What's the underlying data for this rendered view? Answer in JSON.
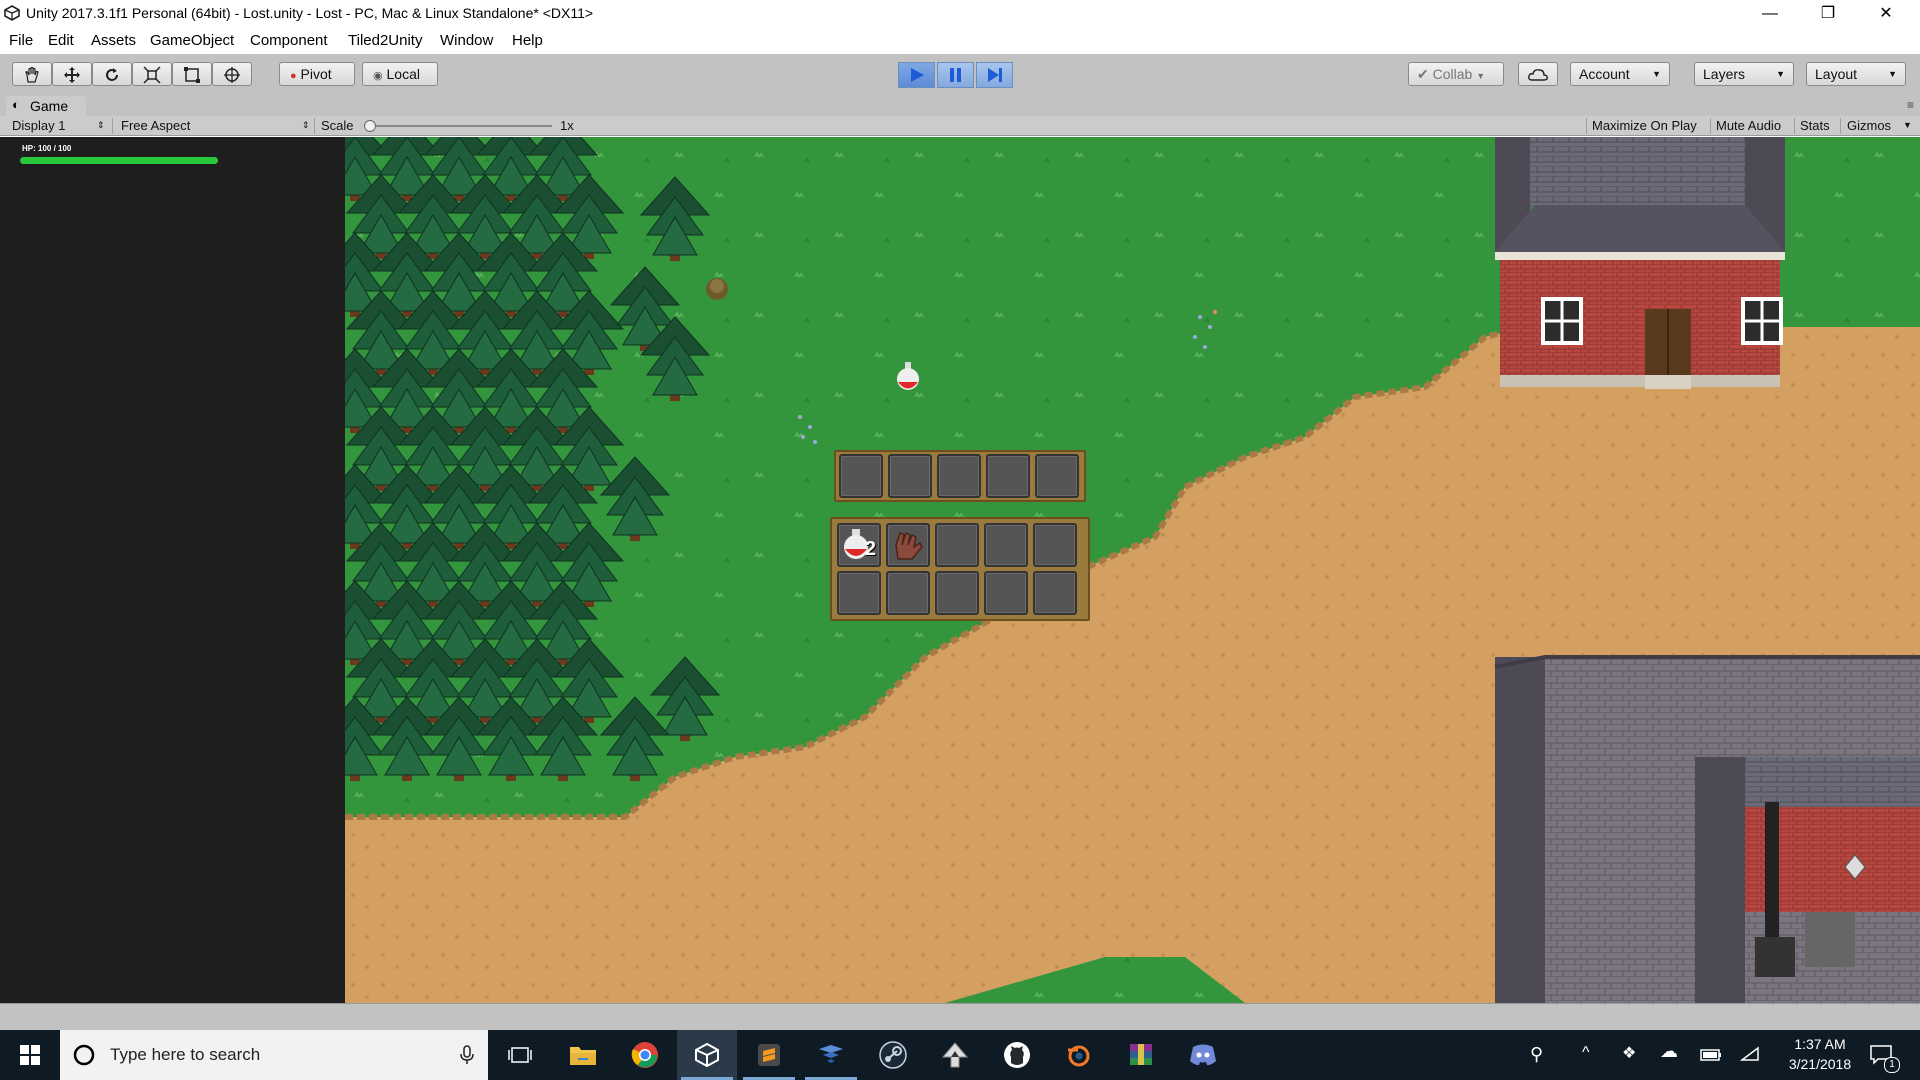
{
  "window": {
    "title": "Unity 2017.3.1f1 Personal (64bit) - Lost.unity - Lost - PC, Mac & Linux Standalone* <DX11>",
    "minimize": "—",
    "maximize": "❐",
    "close": "✕"
  },
  "menu": [
    "File",
    "Edit",
    "Assets",
    "GameObject",
    "Component",
    "Tiled2Unity",
    "Window",
    "Help"
  ],
  "toolbar": {
    "tools": [
      "hand-tool-icon",
      "move-tool-icon",
      "rotate-tool-icon",
      "scale-tool-icon",
      "rect-tool-icon",
      "transform-tool-icon"
    ],
    "pivot_label": "Pivot",
    "local_label": "Local",
    "collab_label": "Collab",
    "account_label": "Account",
    "layers_label": "Layers",
    "layout_label": "Layout"
  },
  "game_panel": {
    "tab_label": "Game",
    "display_label": "Display 1",
    "aspect_label": "Free Aspect",
    "scale_label": "Scale",
    "scale_value": "1x",
    "maximize_on_play": "Maximize On Play",
    "mute_audio": "Mute Audio",
    "stats": "Stats",
    "gizmos": "Gizmos"
  },
  "game": {
    "hp_text": "HP: 100 / 100",
    "hp_fraction": 1.0,
    "potion_count": "2"
  },
  "taskbar": {
    "search_placeholder": "Type here to search",
    "time": "1:37 AM",
    "date": "3/21/2018",
    "notification_count": "1"
  }
}
